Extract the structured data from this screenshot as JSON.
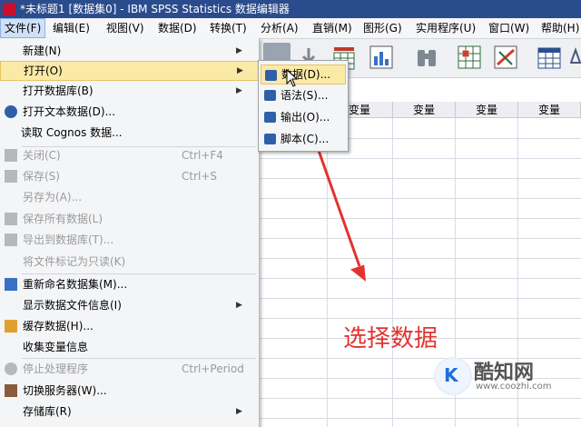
{
  "window": {
    "title": "*未标题1 [数据集0] - IBM SPSS Statistics 数据编辑器"
  },
  "menubar": [
    {
      "label": "文件(F)"
    },
    {
      "label": "编辑(E)"
    },
    {
      "label": "视图(V)"
    },
    {
      "label": "数据(D)"
    },
    {
      "label": "转换(T)"
    },
    {
      "label": "分析(A)"
    },
    {
      "label": "直销(M)"
    },
    {
      "label": "图形(G)"
    },
    {
      "label": "实用程序(U)"
    },
    {
      "label": "窗口(W)"
    },
    {
      "label": "帮助(H)"
    }
  ],
  "file_menu": {
    "items": [
      {
        "label": "新建(N)",
        "submenu": true
      },
      {
        "label": "打开(O)",
        "submenu": true
      },
      {
        "label": "打开数据库(B)",
        "submenu": true
      },
      {
        "label": "打开文本数据(D)..."
      },
      {
        "label": "读取 Cognos 数据..."
      },
      {
        "label": "关闭(C)",
        "shortcut": "Ctrl+F4"
      },
      {
        "label": "保存(S)",
        "shortcut": "Ctrl+S"
      },
      {
        "label": "另存为(A)..."
      },
      {
        "label": "保存所有数据(L)"
      },
      {
        "label": "导出到数据库(T)..."
      },
      {
        "label": "将文件标记为只读(K)"
      },
      {
        "label": "重新命名数据集(M)..."
      },
      {
        "label": "显示数据文件信息(I)",
        "submenu": true
      },
      {
        "label": "缓存数据(H)..."
      },
      {
        "label": "收集变量信息"
      },
      {
        "label": "停止处理程序",
        "shortcut": "Ctrl+Period"
      },
      {
        "label": "切换服务器(W)..."
      },
      {
        "label": "存储库(R)",
        "submenu": true
      }
    ]
  },
  "open_submenu": {
    "items": [
      {
        "label": "数据(D)..."
      },
      {
        "label": "语法(S)..."
      },
      {
        "label": "输出(O)..."
      },
      {
        "label": "脚本(C)..."
      }
    ]
  },
  "grid": {
    "column_header": "变量"
  },
  "annotation": "选择数据",
  "watermark": {
    "logo": "K",
    "name": "酷知网",
    "url": "www.coozhi.com"
  },
  "colors": {
    "highlight": "#fbe9a6",
    "annotation": "#e2342f",
    "titlebar": "#2b4c8c"
  }
}
